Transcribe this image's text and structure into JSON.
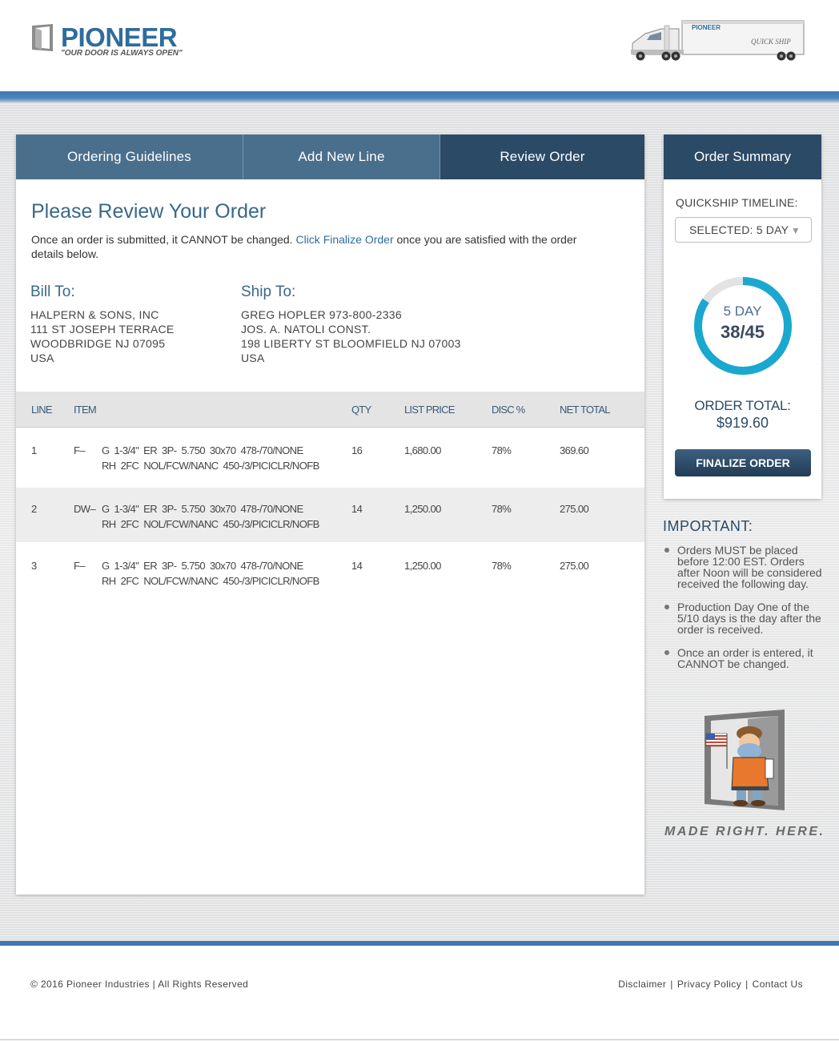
{
  "brand": {
    "name": "PIONEER",
    "tagline": "\"OUR DOOR IS ALWAYS OPEN\"",
    "truck_name": "PIONEER",
    "truck_script": "QUICK SHIP"
  },
  "tabs": [
    {
      "label": "Ordering Guidelines",
      "active": false
    },
    {
      "label": "Add New Line",
      "active": false
    },
    {
      "label": "Review Order",
      "active": true
    }
  ],
  "review": {
    "title": "Please Review Your Order",
    "note_before": "Once an order is submitted, it CANNOT be changed. ",
    "note_link": "Click Finalize Order",
    "note_after": " once you are satisfied with the order details below."
  },
  "bill_to": {
    "heading": "Bill To:",
    "lines": [
      "HALPERN & SONS, INC",
      "111 ST JOSEPH TERRACE",
      "WOODBRIDGE NJ 07095",
      "USA"
    ]
  },
  "ship_to": {
    "heading": "Ship To:",
    "lines": [
      "GREG HOPLER 973-800-2336",
      "JOS. A. NATOLI CONST.",
      "198 LIBERTY ST BLOOMFIELD NJ 07003",
      "USA"
    ]
  },
  "table": {
    "columns": {
      "line": "LINE",
      "item": "ITEM",
      "qty": "QTY",
      "list_price": "LIST PRICE",
      "disc": "DISC %",
      "net_total": "NET TOTAL"
    },
    "rows": [
      {
        "line": "1",
        "item_code": "F–",
        "desc1": "G  1-3/4\"  ER  3P-  5.750  30x70  478-/70/NONE",
        "desc2": "RH  2FC  NOL/FCW/NANC  450-/3/PICICLR/NOFB",
        "qty": "16",
        "list_price": "1,680.00",
        "disc": "78%",
        "net_total": "369.60"
      },
      {
        "line": "2",
        "item_code": "DW–",
        "desc1": "G  1-3/4\"  ER  3P-  5.750  30x70  478-/70/NONE",
        "desc2": "RH  2FC  NOL/FCW/NANC  450-/3/PICICLR/NOFB",
        "qty": "14",
        "list_price": "1,250.00",
        "disc": "78%",
        "net_total": "275.00"
      },
      {
        "line": "3",
        "item_code": "F–",
        "desc1": "G  1-3/4\"  ER  3P-  5.750  30x70  478-/70/NONE",
        "desc2": "RH  2FC  NOL/FCW/NANC  450-/3/PICICLR/NOFB",
        "qty": "14",
        "list_price": "1,250.00",
        "disc": "78%",
        "net_total": "275.00"
      }
    ]
  },
  "summary": {
    "heading": "Order Summary",
    "timeline_label": "QUICKSHIP TIMELINE:",
    "timeline_selected": "SELECTED: 5 DAY",
    "ring_day": "5 DAY",
    "ring_count": "38/45",
    "ring_fraction": 0.844,
    "order_total_label": "ORDER TOTAL:",
    "order_total_value": "$919.60",
    "finalize_label": "FINALIZE ORDER"
  },
  "important": {
    "heading": "IMPORTANT:",
    "items": [
      "Orders MUST be placed before 12:00 EST. Orders after Noon will be considered received the following day.",
      "Production Day One of the 5/10 days is the day after the order is received.",
      "Once an order is entered, it CANNOT be changed."
    ]
  },
  "made_right": "MADE RIGHT. HERE.",
  "footer": {
    "copyright": "© 2016 Pioneer Industries | All Rights Reserved",
    "links": [
      "Disclaimer",
      "Privacy Policy",
      "Contact Us"
    ]
  },
  "colors": {
    "brand_blue": "#2f6c9c",
    "tab_active": "#2b4a66",
    "tab": "#4a6f8d",
    "ring": "#1aa7d0"
  }
}
